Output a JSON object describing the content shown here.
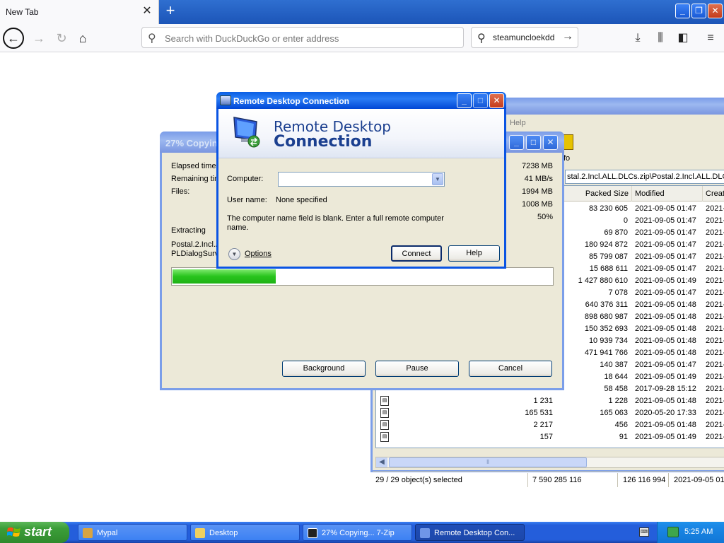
{
  "browser": {
    "tab_title": "New Tab",
    "tab_close_icon": "close-icon",
    "new_tab_icon": "plus-icon",
    "url_placeholder": "Search with DuckDuckGo or enter address",
    "search_text": "steamuncloekdd"
  },
  "zip_manager": {
    "menu_help": "Help",
    "info_label": "fo",
    "path": "stal.2.Incl.ALL.DLCs.zip\\Postal.2.Incl.ALL.DLCs",
    "columns": {
      "packed": "Packed Size",
      "modified": "Modified",
      "created": "Create"
    },
    "rows": [
      {
        "size": "",
        "packed": "83 230 605",
        "modified": "2021-09-05 01:47",
        "created": "2021-0"
      },
      {
        "size": "",
        "packed": "0",
        "modified": "2021-09-05 01:47",
        "created": "2021-0"
      },
      {
        "size": "",
        "packed": "69 870",
        "modified": "2021-09-05 01:47",
        "created": "2021-0"
      },
      {
        "size": "",
        "packed": "180 924 872",
        "modified": "2021-09-05 01:47",
        "created": "2021-0"
      },
      {
        "size": "",
        "packed": "85 799 087",
        "modified": "2021-09-05 01:47",
        "created": "2021-0"
      },
      {
        "size": "",
        "packed": "15 688 611",
        "modified": "2021-09-05 01:47",
        "created": "2021-0"
      },
      {
        "size": "",
        "packed": "1 427 880 610",
        "modified": "2021-09-05 01:49",
        "created": "2021-0"
      },
      {
        "size": "",
        "packed": "7 078",
        "modified": "2021-09-05 01:47",
        "created": "2021-0"
      },
      {
        "size": "",
        "packed": "640 376 311",
        "modified": "2021-09-05 01:48",
        "created": "2021-0"
      },
      {
        "size": "",
        "packed": "898 680 987",
        "modified": "2021-09-05 01:48",
        "created": "2021-0"
      },
      {
        "size": "",
        "packed": "150 352 693",
        "modified": "2021-09-05 01:48",
        "created": "2021-0"
      },
      {
        "size": "",
        "packed": "10 939 734",
        "modified": "2021-09-05 01:48",
        "created": "2021-0"
      },
      {
        "size": "",
        "packed": "471 941 766",
        "modified": "2021-09-05 01:48",
        "created": "2021-0"
      },
      {
        "size": "",
        "packed": "140 387",
        "modified": "2021-09-05 01:47",
        "created": "2021-0"
      },
      {
        "size": "",
        "packed": "18 644",
        "modified": "2021-09-05 01:49",
        "created": "2021-0"
      },
      {
        "size": "",
        "packed": "58 458",
        "modified": "2017-09-28 15:12",
        "created": "2021-0"
      },
      {
        "size": "1 231",
        "packed": "1 228",
        "modified": "2021-09-05 01:48",
        "created": "2021-0"
      },
      {
        "size": "165 531",
        "packed": "165 063",
        "modified": "2020-05-20 17:33",
        "created": "2021-0"
      },
      {
        "size": "2 217",
        "packed": "456",
        "modified": "2021-09-05 01:48",
        "created": "2021-0"
      },
      {
        "size": "157",
        "packed": "91",
        "modified": "2021-09-05 01:49",
        "created": "2021-0"
      }
    ],
    "status": {
      "selected": "29 / 29 object(s) selected",
      "size": "7 590 285 116",
      "packed": "126 116 994",
      "date": "2021-09-05 01:"
    }
  },
  "copy_dialog": {
    "title": "27% Copyin",
    "labels": {
      "elapsed": "Elapsed time:",
      "remaining": "Remaining tim",
      "files": "Files:",
      "extracting": "Extracting",
      "file1": "Postal.2.Incl.A",
      "file2": "PLDialogSurv"
    },
    "values": {
      "total": "7238 MB",
      "speed": "41 MB/s",
      "processed": "1994 MB",
      "packed": "1008 MB",
      "ratio": "50%"
    },
    "progress_fraction": 0.27,
    "buttons": {
      "background": "Background",
      "pause": "Pause",
      "cancel": "Cancel"
    }
  },
  "rdc_dialog": {
    "title": "Remote Desktop Connection",
    "brand_line1": "Remote Desktop",
    "brand_line2": "Connection",
    "computer_label": "Computer:",
    "computer_value": "",
    "username_label": "User name:",
    "username_value": "None specified",
    "message": "The computer name field is blank. Enter a full remote computer name.",
    "options_label": "Options",
    "connect_label": "Connect",
    "help_label": "Help"
  },
  "taskbar": {
    "start_label": "start",
    "tasks": [
      {
        "label": "Mypal"
      },
      {
        "label": "Desktop"
      },
      {
        "label": "27% Copying... 7-Zip"
      },
      {
        "label": "Remote Desktop Con..."
      }
    ],
    "clock": "5:25 AM"
  },
  "colors": {
    "xp_title_blue": "#0a5fe4",
    "progress_green": "#27c41c",
    "taskbar_blue": "#245edb",
    "start_green": "#3c9e39",
    "rdc_brand": "#1b3f8f"
  }
}
